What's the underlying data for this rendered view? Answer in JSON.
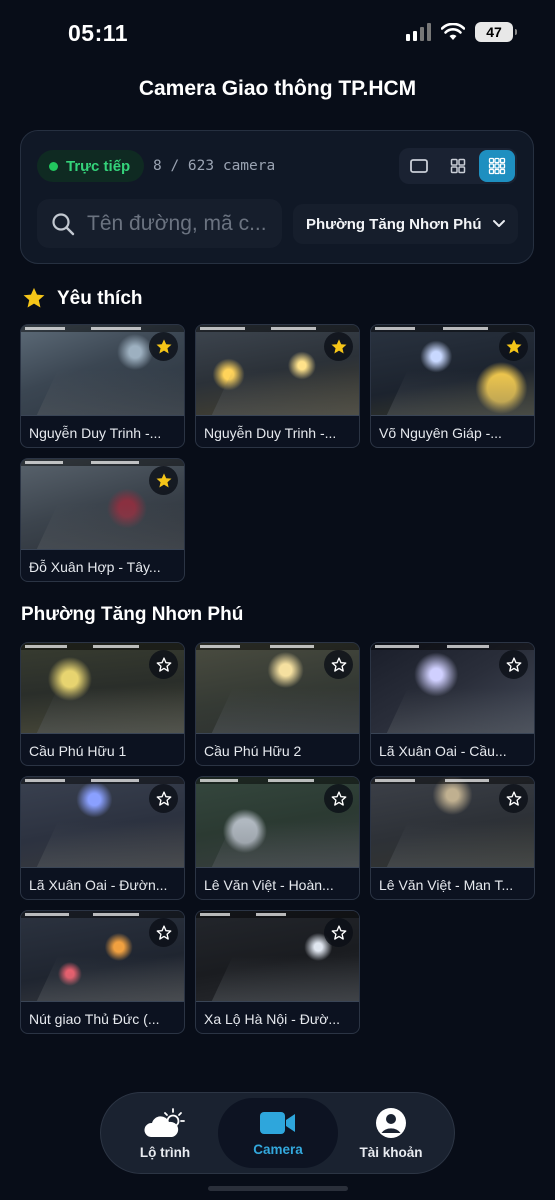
{
  "status_bar": {
    "time": "05:11",
    "battery": "47"
  },
  "header": {
    "title": "Camera Giao thông TP.HCM"
  },
  "controls": {
    "live_label": "Trực tiếp",
    "camera_count": "8 / 623 camera",
    "view_modes": [
      "single-view-icon",
      "grid-2x2-icon",
      "grid-3x3-icon"
    ],
    "active_view": "grid-3x3-icon",
    "search": {
      "placeholder": "Tên đường, mã c...",
      "value": ""
    },
    "ward_select": {
      "value": "Phường Tăng Nhơn Phú"
    }
  },
  "favorites": {
    "title": "Yêu thích",
    "cameras": [
      {
        "name": "Nguyễn Duy Trinh -...",
        "favorite": true
      },
      {
        "name": "Nguyễn Duy Trinh -...",
        "favorite": true
      },
      {
        "name": "Võ Nguyên Giáp -...",
        "favorite": true
      },
      {
        "name": "Đỗ Xuân Hợp - Tây...",
        "favorite": true
      }
    ]
  },
  "ward_section": {
    "title": "Phường Tăng Nhơn Phú",
    "cameras": [
      {
        "name": "Cầu Phú Hữu 1",
        "favorite": false
      },
      {
        "name": "Cầu Phú Hữu 2",
        "favorite": false
      },
      {
        "name": "Lã Xuân Oai - Cầu...",
        "favorite": false
      },
      {
        "name": "Lã Xuân Oai - Đườn...",
        "favorite": false
      },
      {
        "name": "Lê Văn Việt - Hoàn...",
        "favorite": false
      },
      {
        "name": "Lê Văn Việt - Man T...",
        "favorite": false
      },
      {
        "name": "Nút giao Thủ Đức (...",
        "favorite": false
      },
      {
        "name": "Xa Lộ Hà Nội - Đườ...",
        "favorite": false
      }
    ]
  },
  "tabbar": {
    "items": [
      {
        "label": "Lộ trình",
        "icon": "weather-cloud-sun-icon"
      },
      {
        "label": "Camera",
        "icon": "video-camera-icon"
      },
      {
        "label": "Tài khoản",
        "icon": "account-icon"
      }
    ],
    "active": "Camera"
  },
  "colors": {
    "background": "#080d18",
    "accent": "#1e8fc0",
    "live_green": "#22c55e",
    "star_gold": "#f5c518"
  }
}
